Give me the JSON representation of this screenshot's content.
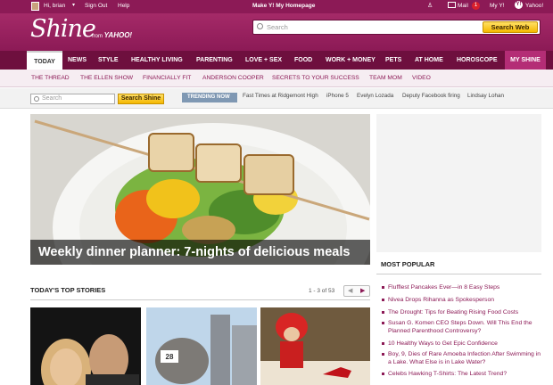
{
  "topbar": {
    "greeting": "Hi, brian",
    "sign_out": "Sign Out",
    "help": "Help",
    "make_home": "Make Y! My Homepage",
    "mail": "Mail",
    "mail_count": "1",
    "my_y": "My Y!",
    "yahoo": "Yahoo!"
  },
  "brand": {
    "name": "Shine",
    "from": "from",
    "partner": "YAHOO!"
  },
  "search": {
    "placeholder": "Search",
    "button": "Search Web"
  },
  "nav": [
    "TODAY",
    "NEWS",
    "STYLE",
    "HEALTHY LIVING",
    "PARENTING",
    "LOVE + SEX",
    "FOOD",
    "WORK + MONEY",
    "PETS",
    "AT HOME",
    "HOROSCOPE",
    "MY SHINE"
  ],
  "subnav": [
    "THE THREAD",
    "THE ELLEN SHOW",
    "FINANCIALLY FIT",
    "ANDERSON COOPER",
    "SECRETS TO YOUR SUCCESS",
    "TEAM MOM",
    "VIDEO"
  ],
  "shine_search": {
    "placeholder": "Search",
    "button": "Search Shine"
  },
  "trending": {
    "label": "TRENDING NOW",
    "items": [
      "Fast Times at Ridgemont High",
      "iPhone 5",
      "Evelyn Lozada",
      "Deputy Facebook firing",
      "Lindsay Lohan"
    ]
  },
  "hero": {
    "caption": "Weekly dinner planner: 7-nights of delicious meals"
  },
  "most_popular": {
    "title": "MOST POPULAR",
    "items": [
      "Flufflest Pancakes Ever—in 8 Easy Steps",
      "Nivea Drops Rihanna as Spokesperson",
      "The Drought: Tips for Beating Rising Food Costs",
      "Susan G. Komen CEO Steps Down. Will This End the Planned Parenthood Controversy?",
      "10 Healthy Ways to Get Epic Confidence",
      "Boy, 9, Dies of Rare Amoeba Infection After Swimming in a Lake. What Else is in Lake Water?",
      "Celebs Hawking T-Shirts: The Latest Trend?"
    ]
  },
  "top_stories": {
    "title": "TODAY'S TOP STORIES",
    "pager": "1 - 3 of 53",
    "prev": "◀",
    "next": "▶",
    "tag": "28"
  },
  "colors": {
    "brand": "#8c1a56",
    "nav": "#6e0f3e",
    "button": "#f5b800",
    "trending": "#7f98b3"
  }
}
